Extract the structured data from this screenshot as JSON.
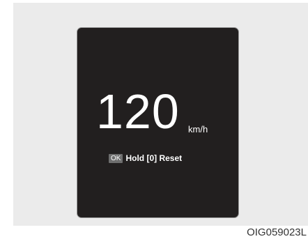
{
  "display": {
    "speed_value": "120",
    "speed_unit": "km/h",
    "ok_key_label": "OK",
    "reset_instruction": "Hold [0] Reset"
  },
  "figure_code": "OIG059023L",
  "colors": {
    "background": "#ebebeb",
    "screen": "#221f1f",
    "screen_border": "#9c9c9c",
    "text": "#ffffff",
    "ok_key": "#6e6e6e"
  }
}
